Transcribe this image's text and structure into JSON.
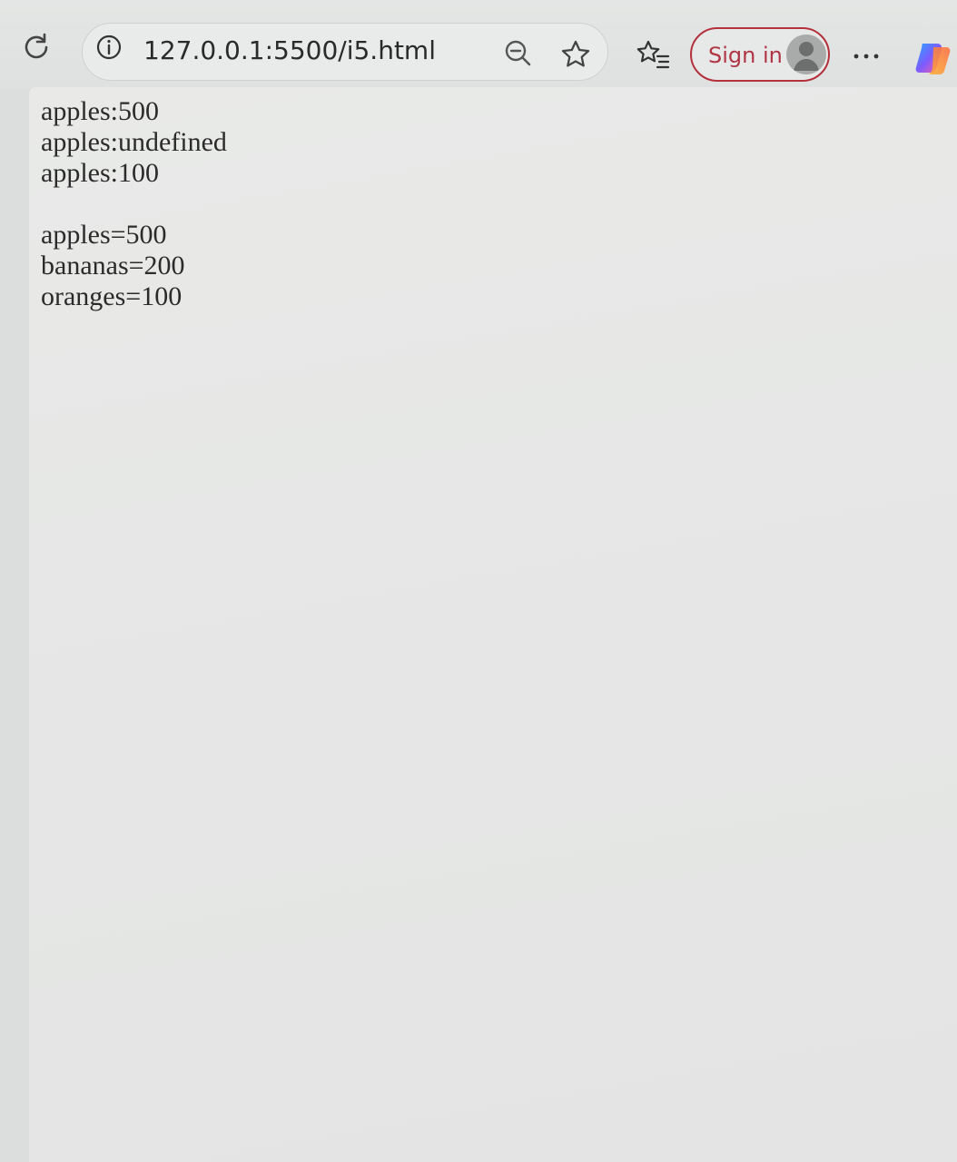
{
  "browser": {
    "url": "127.0.0.1:5500/i5.html",
    "sign_in_label": "Sign in",
    "more_label": "···",
    "icons": [
      "reload-icon",
      "site-info-icon",
      "zoom-out-icon",
      "star-icon",
      "favorites-icon",
      "avatar-icon",
      "more-icon",
      "copilot-icon"
    ],
    "accent_color": "#b3303c"
  },
  "page": {
    "block1": [
      "apples:500",
      "apples:undefined",
      "apples:100"
    ],
    "block2": [
      "apples=500",
      "bananas=200",
      "oranges=100"
    ]
  }
}
